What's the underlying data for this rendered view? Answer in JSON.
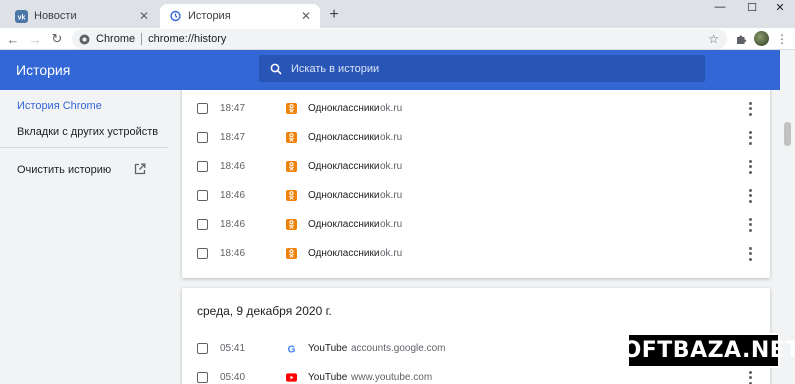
{
  "browser": {
    "tabs": [
      {
        "title": "Новости",
        "icon": "vk-icon",
        "active": false
      },
      {
        "title": "История",
        "icon": "history-icon",
        "active": true
      }
    ],
    "omnibox": {
      "chip": "Chrome",
      "url": "chrome://history"
    }
  },
  "page": {
    "title": "История",
    "search_placeholder": "Искать в истории"
  },
  "sidebar": {
    "items": [
      {
        "label": "История Chrome",
        "active": true
      },
      {
        "label": "Вкладки с других устройств",
        "active": false
      },
      {
        "label": "Очистить историю",
        "active": false
      }
    ]
  },
  "history": {
    "group1": {
      "rows": [
        {
          "time": "18:47",
          "title": "Одноклассники",
          "domain": "ok.ru",
          "icon": "odnoklassniki-icon"
        },
        {
          "time": "18:47",
          "title": "Одноклассники",
          "domain": "ok.ru",
          "icon": "odnoklassniki-icon"
        },
        {
          "time": "18:46",
          "title": "Одноклассники",
          "domain": "ok.ru",
          "icon": "odnoklassniki-icon"
        },
        {
          "time": "18:46",
          "title": "Одноклассники",
          "domain": "ok.ru",
          "icon": "odnoklassniki-icon"
        },
        {
          "time": "18:46",
          "title": "Одноклассники",
          "domain": "ok.ru",
          "icon": "odnoklassniki-icon"
        },
        {
          "time": "18:46",
          "title": "Одноклассники",
          "domain": "ok.ru",
          "icon": "odnoklassniki-icon"
        }
      ]
    },
    "group2": {
      "date": "среда, 9 декабря 2020 г.",
      "rows": [
        {
          "time": "05:41",
          "title": "YouTube",
          "domain": "accounts.google.com",
          "icon": "google-icon"
        },
        {
          "time": "05:40",
          "title": "YouTube",
          "domain": "www.youtube.com",
          "icon": "youtube-icon"
        }
      ]
    }
  },
  "watermark": "SOFTBAZA.NET",
  "colors": {
    "header": "#3367d6",
    "accent": "#3367d6",
    "ok_orange": "#ee8208",
    "youtube_red": "#ff0000"
  }
}
